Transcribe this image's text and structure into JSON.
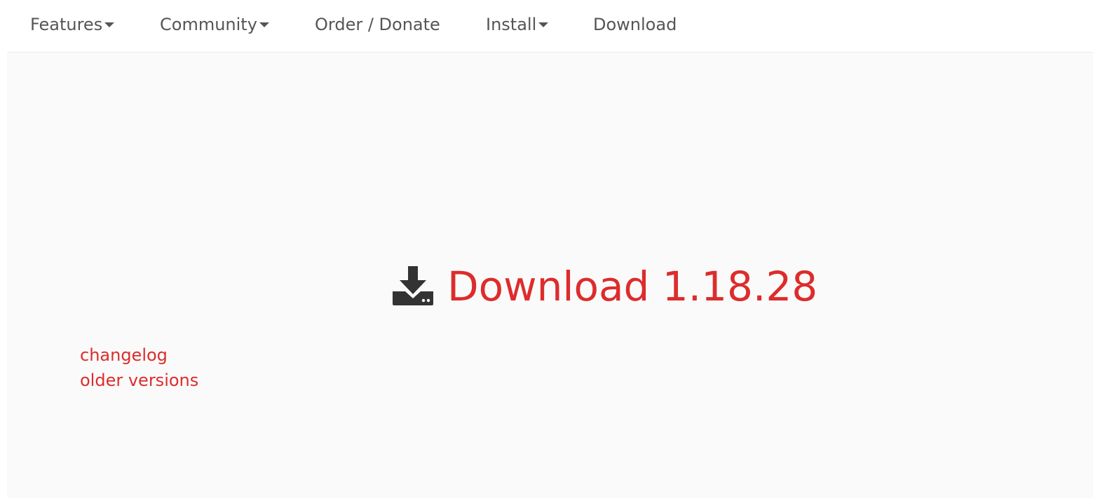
{
  "nav": {
    "items": [
      {
        "label": "Features",
        "dropdown": true
      },
      {
        "label": "Community",
        "dropdown": true
      },
      {
        "label": "Order / Donate",
        "dropdown": false
      },
      {
        "label": "Install",
        "dropdown": true
      },
      {
        "label": "Download",
        "dropdown": false
      }
    ]
  },
  "main": {
    "download_label": "Download 1.18.28",
    "download_icon": "download-tray-icon",
    "links": {
      "changelog": "changelog",
      "older_versions": "older versions"
    }
  },
  "colors": {
    "accent": "#dd2c2c",
    "nav_text": "#555555",
    "icon": "#333333",
    "content_bg": "#fafafa"
  }
}
